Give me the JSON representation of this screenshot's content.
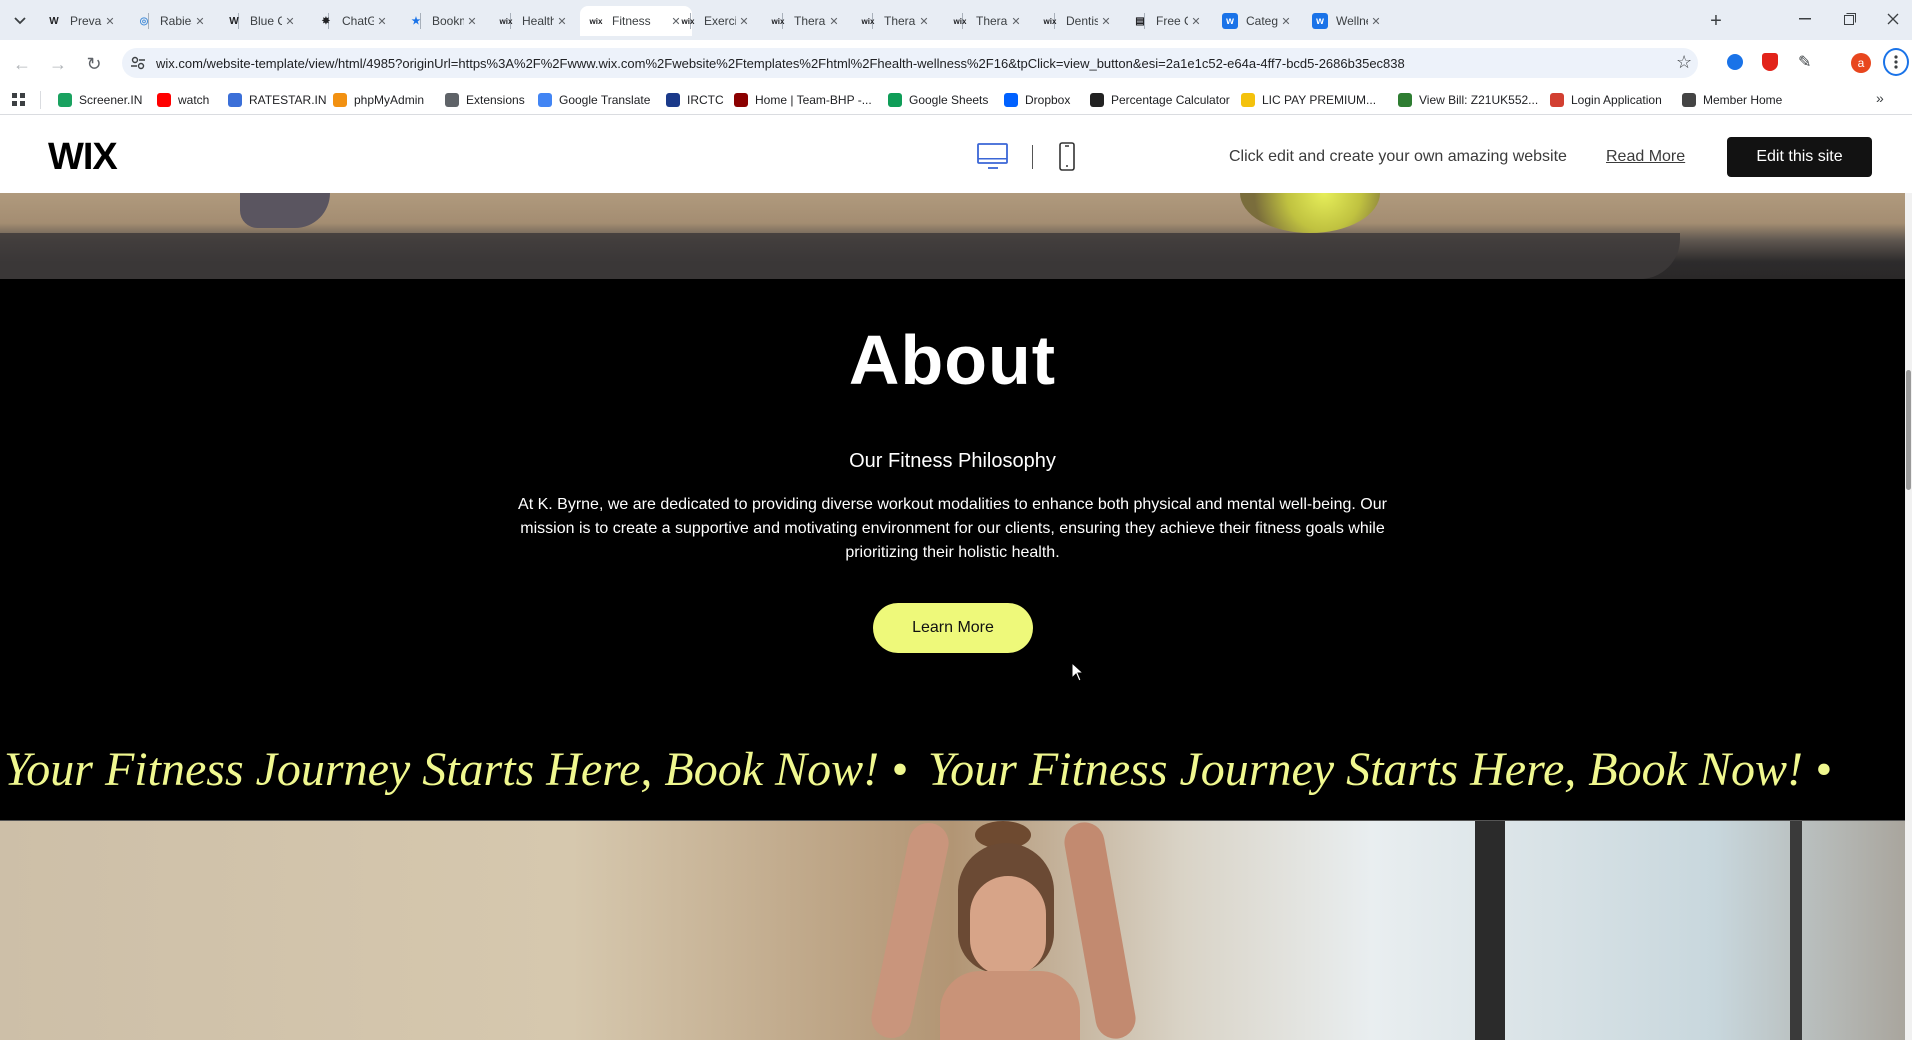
{
  "browser": {
    "tabs": [
      {
        "title": "Prevale",
        "icon": "W"
      },
      {
        "title": "Rabies",
        "icon": "un"
      },
      {
        "title": "Blue Cr",
        "icon": "W"
      },
      {
        "title": "ChatGP",
        "icon": "gpt"
      },
      {
        "title": "Bookm",
        "icon": "star"
      },
      {
        "title": "Health",
        "icon": "wix"
      },
      {
        "title": "Fitness",
        "icon": "wix"
      },
      {
        "title": "Exercis",
        "icon": "wix"
      },
      {
        "title": "Therap",
        "icon": "wix"
      },
      {
        "title": "Therap",
        "icon": "wix"
      },
      {
        "title": "Therap",
        "icon": "wix"
      },
      {
        "title": "Dentist",
        "icon": "wix"
      },
      {
        "title": "Free Cr",
        "icon": "doc"
      },
      {
        "title": "Catego",
        "icon": "w-blue"
      },
      {
        "title": "Wellne",
        "icon": "w-blue"
      }
    ],
    "active_tab": "Fitness",
    "url": "wix.com/website-template/view/html/4985?originUrl=https%3A%2F%2Fwww.wix.com%2Fwebsite%2Ftemplates%2Fhtml%2Fhealth-wellness%2F16&tpClick=view_button&esi=2a1e1c52-e64a-4ff7-bcd5-2686b35ec838",
    "profile_initial": "a",
    "bookmarks": [
      {
        "label": "Screener.IN",
        "color": "#1aa260"
      },
      {
        "label": "watch",
        "color": "#ff0000"
      },
      {
        "label": "RATESTAR.IN",
        "color": "#3b6fd8"
      },
      {
        "label": "phpMyAdmin",
        "color": "#f29111"
      },
      {
        "label": "Extensions",
        "color": "#5f6368"
      },
      {
        "label": "Google Translate",
        "color": "#4285f4"
      },
      {
        "label": "IRCTC",
        "color": "#1b3a8a"
      },
      {
        "label": "Home | Team-BHP -...",
        "color": "#8b0000"
      },
      {
        "label": "Google Sheets",
        "color": "#0f9d58"
      },
      {
        "label": "Dropbox",
        "color": "#0061ff"
      },
      {
        "label": "Percentage Calculator",
        "color": "#222222"
      },
      {
        "label": "LIC PAY PREMIUM...",
        "color": "#f4c20d"
      },
      {
        "label": "View Bill: Z21UK552...",
        "color": "#2e7d32"
      },
      {
        "label": "Login Application",
        "color": "#d23f31"
      },
      {
        "label": "Member Home",
        "color": "#444444"
      }
    ]
  },
  "wixbar": {
    "logo": "WIX",
    "message": "Click edit and create your own amazing website",
    "read_more": "Read More",
    "edit_button": "Edit this site"
  },
  "site": {
    "about_heading": "About",
    "about_subheading": "Our Fitness Philosophy",
    "about_text": "At K. Byrne, we are dedicated to providing diverse workout modalities to enhance both physical and mental well-being. Our mission is to create a supportive and motivating environment for our clients, ensuring they achieve their fitness goals while prioritizing their holistic health.",
    "learn_more": "Learn More",
    "marquee": [
      "Your Fitness Journey Starts Here, Book Now!  •",
      "Your Fitness Journey Starts Here, Book Now!  •"
    ]
  }
}
